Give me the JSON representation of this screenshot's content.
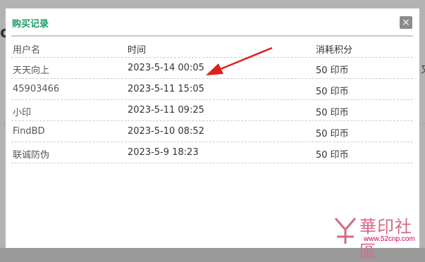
{
  "dialog": {
    "title": "购买记录",
    "close_label": "×"
  },
  "table": {
    "headers": [
      "用户名",
      "时间",
      "消耗积分"
    ],
    "rows": [
      {
        "user": "天天向上",
        "time": "2023-5-14 00:05",
        "points": "50 印币"
      },
      {
        "user": "45903466",
        "time": "2023-5-11 15:05",
        "points": "50 印币"
      },
      {
        "user": "小印",
        "time": "2023-5-11 09:25",
        "points": "50 印币"
      },
      {
        "user": "FindBD",
        "time": "2023-5-10 08:52",
        "points": "50 印币"
      },
      {
        "user": "联诚防伪",
        "time": "2023-5-9 18:23",
        "points": "50 印币"
      }
    ]
  },
  "watermark": {
    "text": "華印社區",
    "url": "www.52cnp.com"
  },
  "colors": {
    "accent": "#1e9c6a",
    "arrow": "#e02020"
  },
  "icons": {
    "close": "close-icon",
    "arrow": "red-arrow-annotation",
    "logo": "huayin-logo-icon"
  }
}
